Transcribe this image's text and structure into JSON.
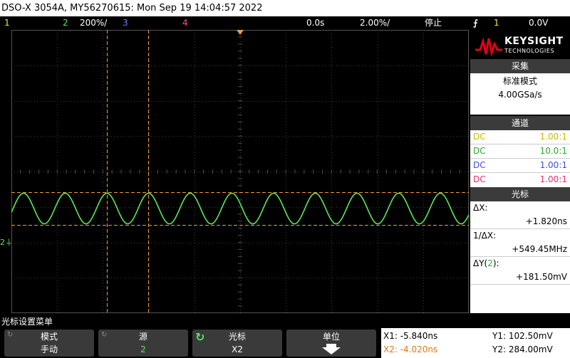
{
  "title": "DSO-X 3054A, MY56270615: Mon Sep 19 14:04:57 2022",
  "topbar": {
    "ch1": "1",
    "ch2": "2",
    "ch2_scale": "200%/",
    "ch3": "3",
    "ch4": "4",
    "delay": "0.0s",
    "timebase": "2.00%/",
    "run_state": "停止",
    "trigger_icon": "trigger-edge-icon",
    "trigger_source": "1",
    "trigger_level": "0.0V"
  },
  "colors": {
    "ch1": "#f3e640",
    "ch2": "#5ce65c",
    "ch3": "#6a7cff",
    "ch4": "#ff4d8a",
    "cursor": "#f29a3a",
    "grid": "#3a3a3a"
  },
  "brand": {
    "name": "KEYSIGHT",
    "sub": "TECHNOLOGIES"
  },
  "acquire": {
    "header": "采集",
    "mode": "标准模式",
    "rate": "4.00GSa/s"
  },
  "channels": {
    "header": "通道",
    "rows": [
      {
        "coupling": "DC",
        "probe": "1.00:1"
      },
      {
        "coupling": "DC",
        "probe": "10.0:1"
      },
      {
        "coupling": "DC",
        "probe": "1.00:1"
      },
      {
        "coupling": "DC",
        "probe": "1.00:1"
      }
    ]
  },
  "cursors": {
    "header": "光标",
    "dx_label": "ΔX:",
    "dx_value": "+1.820ns",
    "inv_dx_label": "1/ΔX:",
    "inv_dx_value": "+549.45MHz",
    "dy_label_prefix": "ΔY(",
    "dy_label_ch": "2",
    "dy_label_suffix": "):",
    "dy_value": "+181.50mV"
  },
  "menu_title": "光标设置菜单",
  "softkeys": [
    {
      "label": "模式",
      "value": "手动"
    },
    {
      "label": "源",
      "value": "2"
    },
    {
      "label": "光标",
      "value": "X2"
    },
    {
      "label": "单位",
      "value": ""
    }
  ],
  "readout": {
    "x1": "X1: -5.840ns",
    "x2": "X2: -4.020ns",
    "y1": "Y1: 102.50mV",
    "y2": "Y2: 284.00mV"
  },
  "ground_marker": "2"
}
